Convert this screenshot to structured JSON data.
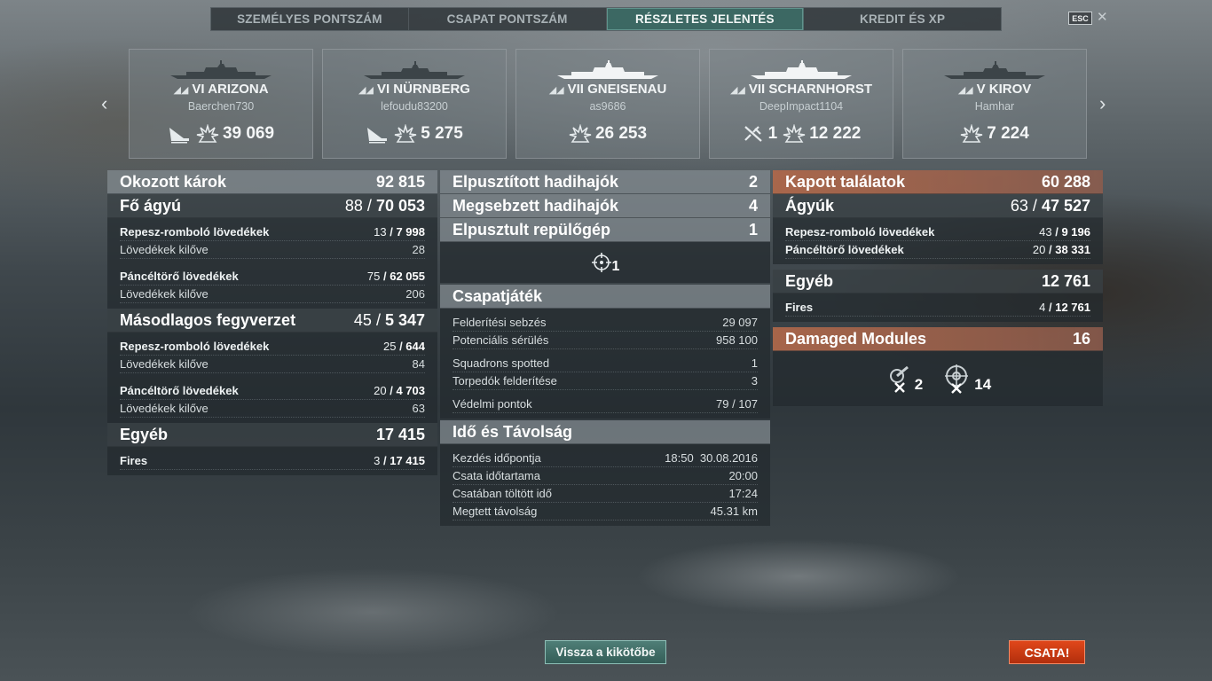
{
  "tabs": [
    {
      "label": "SZEMÉLYES PONTSZÁM",
      "active": false
    },
    {
      "label": "CSAPAT PONTSZÁM",
      "active": false
    },
    {
      "label": "RÉSZLETES JELENTÉS",
      "active": true
    },
    {
      "label": "KREDIT ÉS XP",
      "active": false
    }
  ],
  "esc_label": "ESC",
  "close_glyph": "✕",
  "arrows": {
    "left": "‹",
    "right": "›"
  },
  "ships": [
    {
      "tier": "VI",
      "name": "ARIZONA",
      "player": "Baerchen730",
      "kills": "",
      "damage": "39 069",
      "icons": [
        "ship-sunk-icon",
        "explosion-icon"
      ]
    },
    {
      "tier": "VI",
      "name": "NÜRNBERG",
      "player": "lefoudu83200",
      "kills": "",
      "damage": "5 275",
      "icons": [
        "ship-sunk-icon",
        "explosion-icon"
      ]
    },
    {
      "tier": "VII",
      "name": "GNEISENAU",
      "player": "as9686",
      "kills": "",
      "damage": "26 253",
      "icons": [
        "explosion-icon"
      ]
    },
    {
      "tier": "VII",
      "name": "SCHARNHORST",
      "player": "DeepImpact1104",
      "kills": "1",
      "damage": "12 222",
      "icons": [
        "plane-kill-icon",
        "explosion-icon"
      ]
    },
    {
      "tier": "V",
      "name": "KIROV",
      "player": "Hamhar",
      "kills": "",
      "damage": "7 224",
      "icons": [
        "explosion-icon"
      ]
    }
  ],
  "left": {
    "damage_header": {
      "label": "Okozott károk",
      "value": "92 815"
    },
    "main_battery": {
      "label": "Fő ágyú",
      "hits": "88",
      "value": "70 053"
    },
    "he_label": "Repesz-romboló lövedékek",
    "he_hits": "13",
    "he_value": "7 998",
    "he_fired_label": "Lövedékek kilőve",
    "he_fired": "28",
    "ap_label": "Páncéltörő lövedékek",
    "ap_hits": "75",
    "ap_value": "62 055",
    "ap_fired_label": "Lövedékek kilőve",
    "ap_fired": "206",
    "secondary": {
      "label": "Másodlagos fegyverzet",
      "hits": "45",
      "value": "5 347"
    },
    "sec_he_label": "Repesz-romboló lövedékek",
    "sec_he_hits": "25",
    "sec_he_value": "644",
    "sec_he_fired_label": "Lövedékek kilőve",
    "sec_he_fired": "84",
    "sec_ap_label": "Páncéltörő lövedékek",
    "sec_ap_hits": "20",
    "sec_ap_value": "4 703",
    "sec_ap_fired_label": "Lövedékek kilőve",
    "sec_ap_fired": "63",
    "other": {
      "label": "Egyéb",
      "value": "17 415"
    },
    "fires_label": "Fires",
    "fires_hits": "3",
    "fires_value": "17 415"
  },
  "mid": {
    "destroyed": {
      "label": "Elpusztított hadihajók",
      "value": "2"
    },
    "damaged": {
      "label": "Megsebzett hadihajók",
      "value": "4"
    },
    "planes": {
      "label": "Elpusztult repülőgép",
      "value": "1"
    },
    "crosshair_count": "1",
    "teamplay_header": "Csapatjáték",
    "teamplay": [
      {
        "label": "Felderítési sebzés",
        "value": "29 097"
      },
      {
        "label": "Potenciális sérülés",
        "value": "958 100"
      },
      {
        "label": "Squadrons spotted",
        "value": "1"
      },
      {
        "label": "Torpedók felderítése",
        "value": "3"
      },
      {
        "label": "Védelmi pontok",
        "value": "79 / 107"
      }
    ],
    "time_header": "Idő és Távolság",
    "time": [
      {
        "label": "Kezdés időpontja",
        "value": "18:50  30.08.2016"
      },
      {
        "label": "Csata időtartama",
        "value": "20:00"
      },
      {
        "label": "Csatában töltött idő",
        "value": "17:24"
      },
      {
        "label": "Megtett távolság",
        "value": "45.31 km"
      }
    ]
  },
  "right": {
    "received": {
      "label": "Kapott találatok",
      "value": "60 288"
    },
    "guns": {
      "label": "Ágyúk",
      "hits": "63",
      "value": "47 527"
    },
    "he_label": "Repesz-romboló lövedékek",
    "he_hits": "43",
    "he_value": "9 196",
    "ap_label": "Páncéltörő lövedékek",
    "ap_hits": "20",
    "ap_value": "38 331",
    "other": {
      "label": "Egyéb",
      "value": "12 761"
    },
    "fires_label": "Fires",
    "fires_hits": "4",
    "fires_value": "12 761",
    "modules": {
      "label": "Damaged Modules",
      "value": "16"
    },
    "module_items": [
      {
        "icon": "gun-module-icon",
        "count": "2"
      },
      {
        "icon": "steering-module-icon",
        "count": "14"
      }
    ]
  },
  "buttons": {
    "port": "Vissza a kikötőbe",
    "battle": "CSATA!"
  },
  "colors": {
    "accent_tab": "#3c6e69",
    "received_header": "#b0684a",
    "battle_button": "#d9401a"
  }
}
